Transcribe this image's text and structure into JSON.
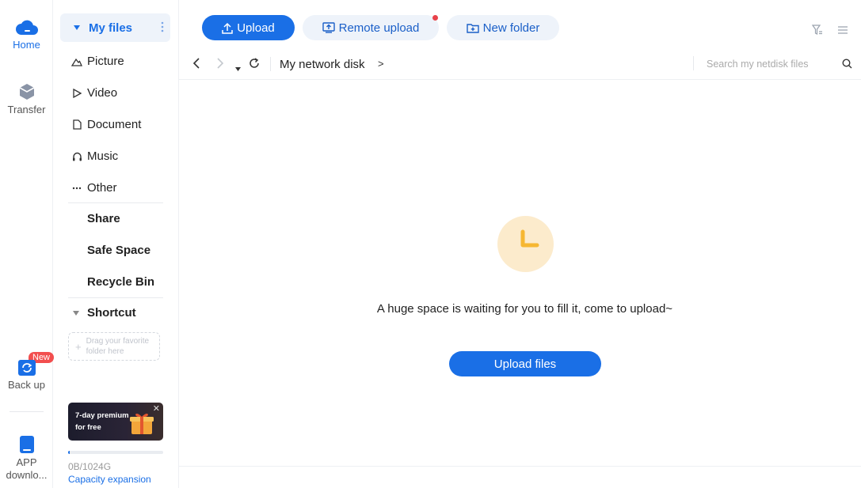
{
  "rail": {
    "home_label": "Home",
    "transfer_label": "Transfer",
    "backup_label": "Back up",
    "backup_badge": "New",
    "app_label_line1": "APP",
    "app_label_line2": "downlo...",
    "accent": "#1a6fe6"
  },
  "sidebar": {
    "my_files": "My files",
    "categories": [
      {
        "label": "Picture",
        "icon": "picture-icon"
      },
      {
        "label": "Video",
        "icon": "video-icon"
      },
      {
        "label": "Document",
        "icon": "document-icon"
      },
      {
        "label": "Music",
        "icon": "music-icon"
      },
      {
        "label": "Other",
        "icon": "more-icon"
      }
    ],
    "share": "Share",
    "safe_space": "Safe Space",
    "recycle_bin": "Recycle Bin",
    "shortcut": "Shortcut",
    "drop_hint_line1": "Drag your favorite",
    "drop_hint_line2": "folder here",
    "promo_line1": "7-day premium",
    "promo_line2": "for free",
    "capacity_text": "0B/1024G",
    "capacity_fraction": 0.02,
    "capacity_link": "Capacity expansion"
  },
  "toolbar": {
    "upload_label": "Upload",
    "remote_upload_label": "Remote upload",
    "new_folder_label": "New folder"
  },
  "pathbar": {
    "path": "My network disk",
    "arrow": ">",
    "search_placeholder": "Search my netdisk files"
  },
  "empty_state": {
    "message": "A huge space is waiting for you to fill it, come to upload~",
    "button_label": "Upload files"
  }
}
